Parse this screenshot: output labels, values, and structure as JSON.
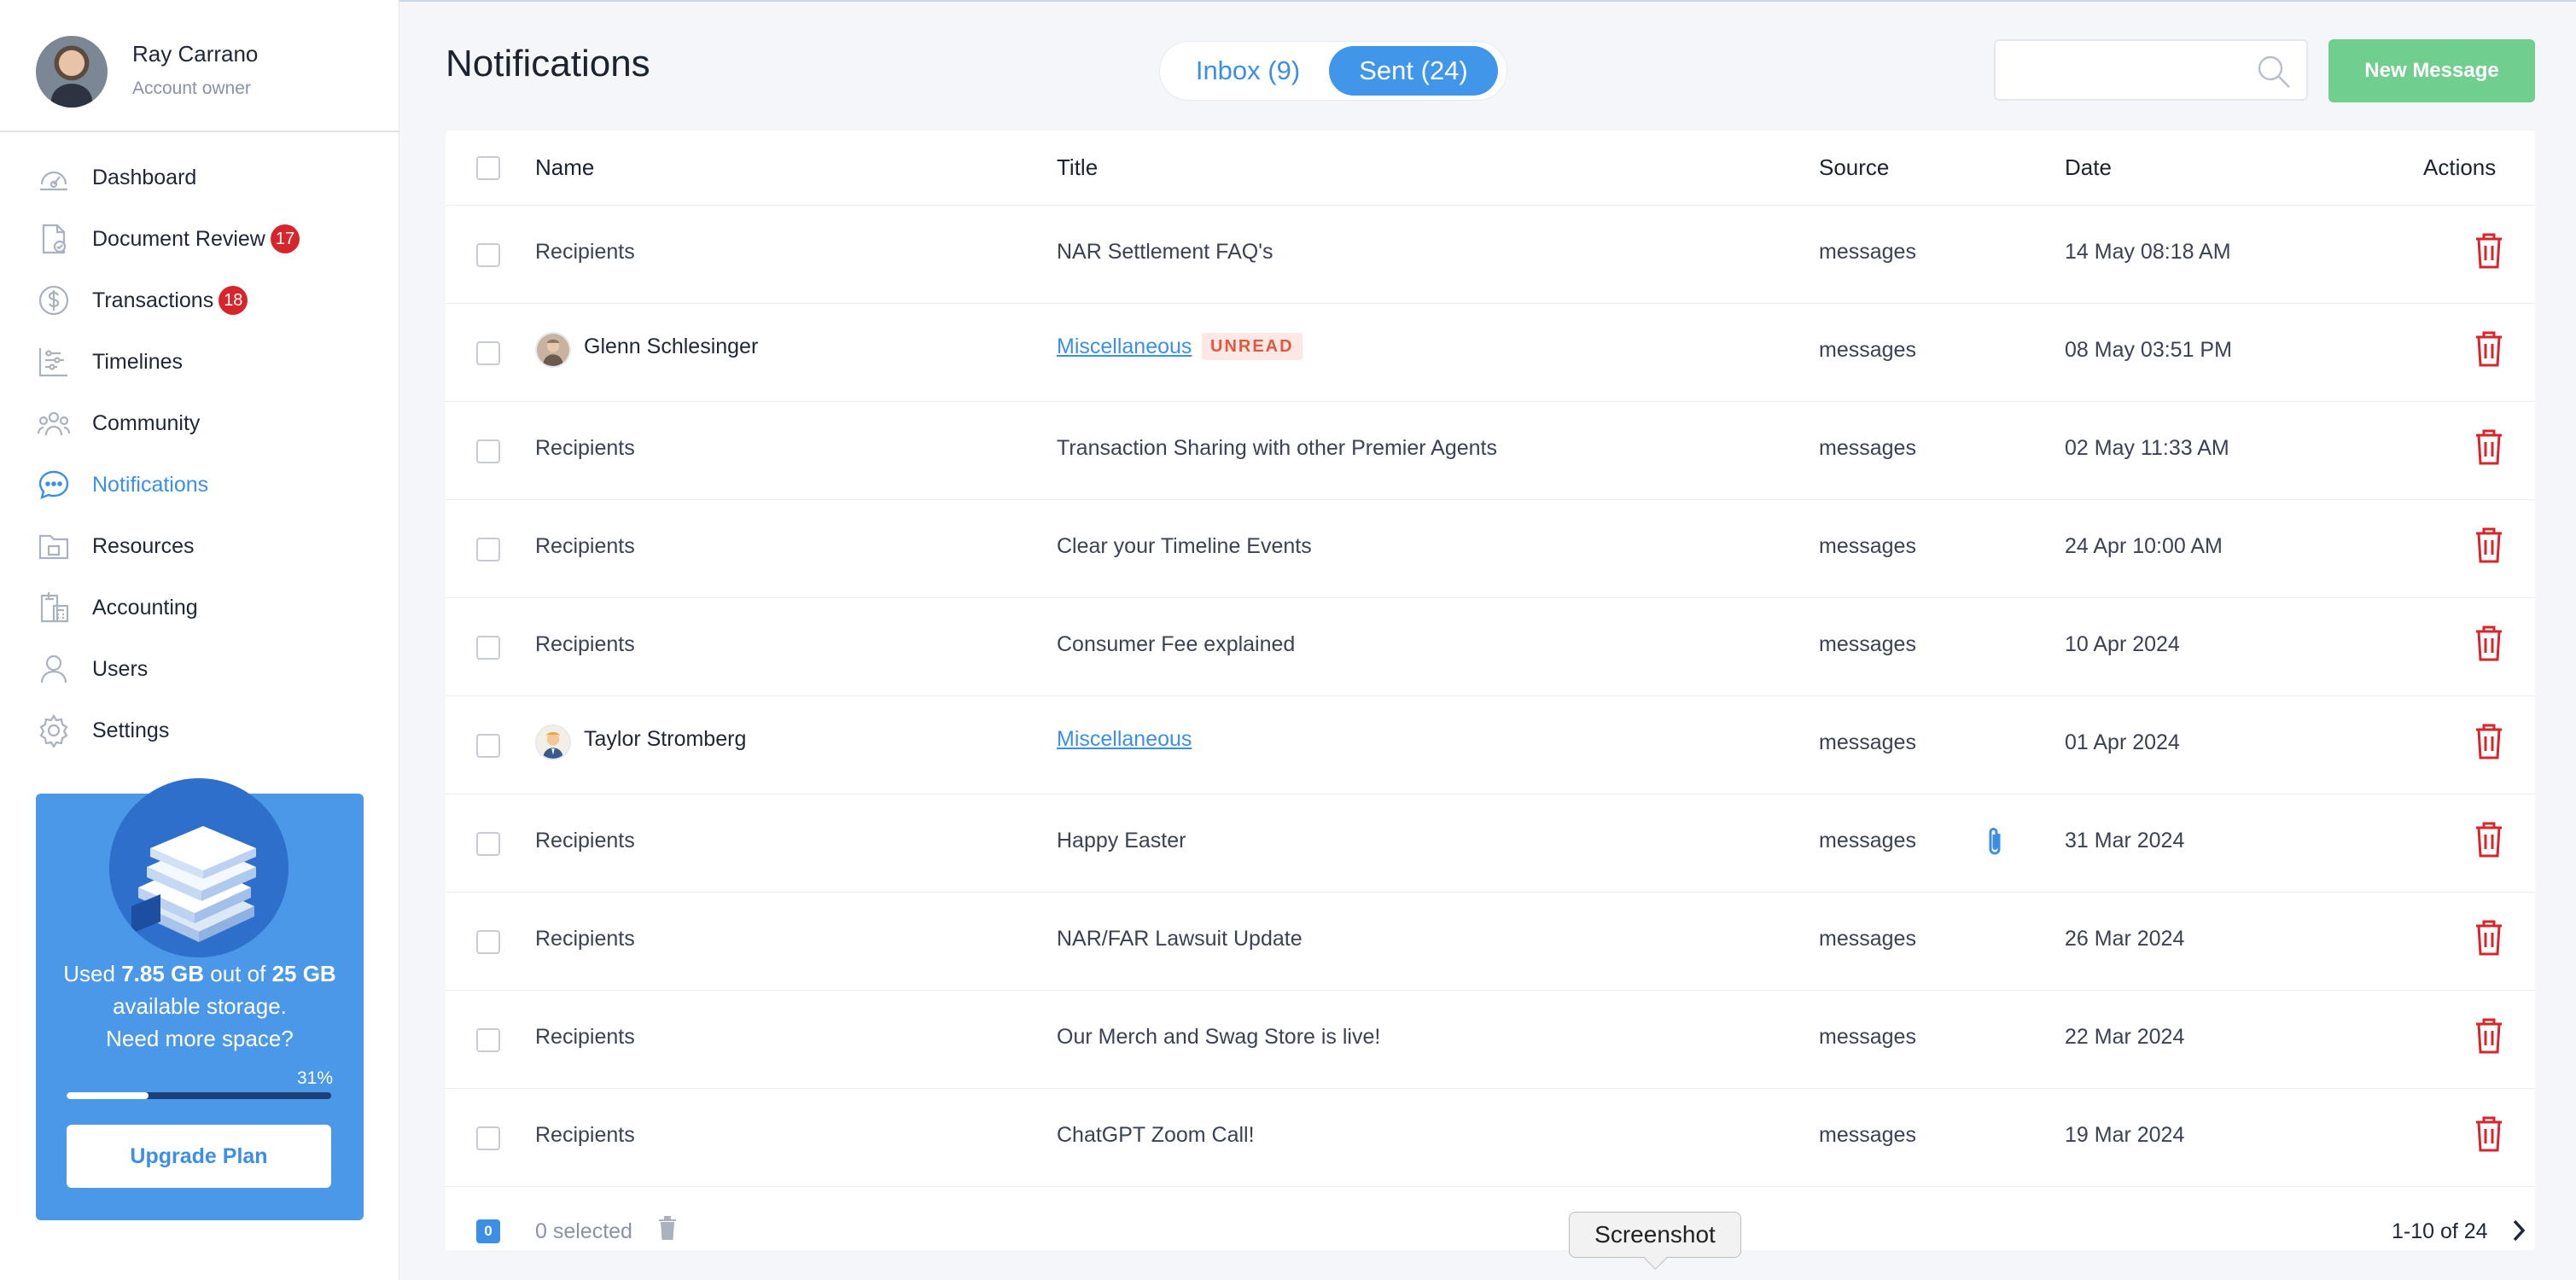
{
  "profile": {
    "name": "Ray Carrano",
    "role": "Account owner"
  },
  "sidebar": {
    "items": [
      {
        "label": "Dashboard",
        "icon": "dashboard-icon"
      },
      {
        "label": "Document Review",
        "icon": "document-check-icon",
        "badge": "17"
      },
      {
        "label": "Transactions",
        "icon": "dollar-icon",
        "badge": "18"
      },
      {
        "label": "Timelines",
        "icon": "timeline-icon"
      },
      {
        "label": "Community",
        "icon": "community-icon"
      },
      {
        "label": "Notifications",
        "icon": "chat-bubble-icon",
        "active": true
      },
      {
        "label": "Resources",
        "icon": "folder-icon"
      },
      {
        "label": "Accounting",
        "icon": "calculator-icon"
      },
      {
        "label": "Users",
        "icon": "user-icon"
      },
      {
        "label": "Settings",
        "icon": "gear-icon"
      }
    ]
  },
  "storage": {
    "used_prefix": "Used",
    "used": "7.85 GB",
    "out_of": "out of",
    "total": "25 GB",
    "suffix": "available storage.",
    "question": "Need more space?",
    "percent_label": "31%",
    "percent": 31,
    "upgrade_label": "Upgrade Plan"
  },
  "header": {
    "title": "Notifications",
    "tab_inbox": "Inbox (9)",
    "tab_sent": "Sent (24)",
    "search_placeholder": "",
    "new_message_label": "New Message"
  },
  "table": {
    "columns": {
      "name": "Name",
      "title": "Title",
      "source": "Source",
      "date": "Date",
      "actions": "Actions"
    },
    "rows": [
      {
        "name": "Recipients",
        "title": "NAR Settlement FAQ's",
        "source": "messages",
        "date": "14 May 08:18 AM"
      },
      {
        "name": "Glenn Schlesinger",
        "title": "Miscellaneous",
        "badge": "UNREAD",
        "source": "messages",
        "date": "08 May 03:51 PM"
      },
      {
        "name": "Recipients",
        "title": "Transaction Sharing with other Premier Agents",
        "source": "messages",
        "date": "02 May 11:33 AM"
      },
      {
        "name": "Recipients",
        "title": "Clear your Timeline Events",
        "source": "messages",
        "date": "24 Apr 10:00 AM"
      },
      {
        "name": "Recipients",
        "title": "Consumer Fee explained",
        "source": "messages",
        "date": "10 Apr 2024"
      },
      {
        "name": "Taylor Stromberg",
        "title": "Miscellaneous",
        "source": "messages",
        "date": "01 Apr 2024"
      },
      {
        "name": "Recipients",
        "title": "Happy Easter",
        "source": "messages",
        "date": "31 Mar 2024",
        "attachment": true
      },
      {
        "name": "Recipients",
        "title": "NAR/FAR Lawsuit Update",
        "source": "messages",
        "date": "26 Mar 2024"
      },
      {
        "name": "Recipients",
        "title": "Our Merch and Swag Store is live!",
        "source": "messages",
        "date": "22 Mar 2024"
      },
      {
        "name": "Recipients",
        "title": "ChatGPT Zoom Call!",
        "source": "messages",
        "date": "19 Mar 2024"
      }
    ],
    "footer": {
      "check_count": "0",
      "selected": "0 selected",
      "pagination": "1-10 of 24"
    }
  },
  "tooltip": "Screenshot",
  "colors": {
    "accent": "#4096e8",
    "success": "#70cf8e",
    "danger": "#d7262b",
    "unread_bg": "#fde8e6"
  }
}
